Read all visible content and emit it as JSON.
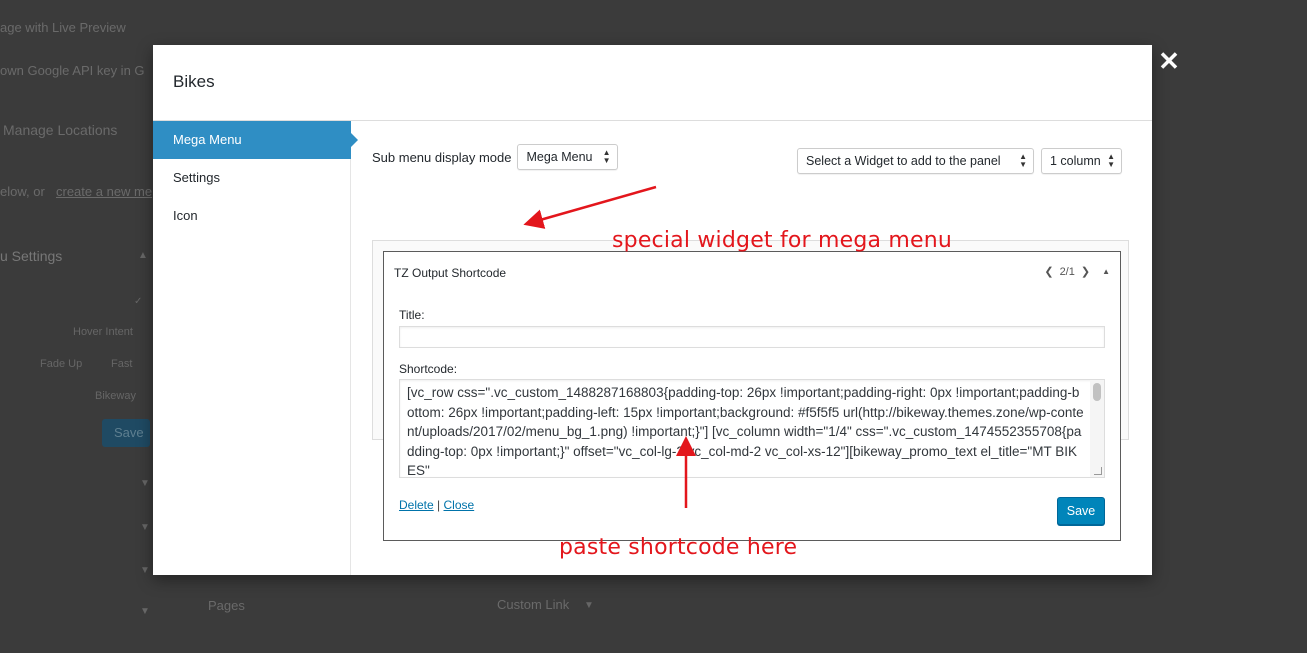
{
  "background": {
    "texts": [
      "age with Live Preview",
      "own Google API key in G",
      "Manage Locations",
      "elow, or",
      "create a new me",
      "u Settings",
      "Hover Intent",
      "Fade Up",
      "Fast",
      "Bikeway",
      "Save",
      "Pages",
      "Custom Link"
    ]
  },
  "modal": {
    "title": "Bikes",
    "close_icon": "close-icon"
  },
  "sidebar": {
    "items": [
      {
        "label": "Mega Menu"
      },
      {
        "label": "Settings"
      },
      {
        "label": "Icon"
      }
    ]
  },
  "controls": {
    "mode_label": "Sub menu display mode",
    "mode_value": "Mega Menu",
    "widget_select": "Select a Widget to add to the panel",
    "column_select": "1 column"
  },
  "widget": {
    "title": "TZ Output Shortcode",
    "pager": "2/1",
    "title_label": "Title:",
    "title_value": "",
    "shortcode_label": "Shortcode:",
    "shortcode_value": "[vc_row css=\".vc_custom_1488287168803{padding-top: 26px !important;padding-right: 0px !important;padding-bottom: 26px !important;padding-left: 15px !important;background: #f5f5f5 url(http://bikeway.themes.zone/wp-content/uploads/2017/02/menu_bg_1.png) !important;}\"] [vc_column width=\"1/4\" css=\".vc_custom_1474552355708{padding-top: 0px !important;}\" offset=\"vc_col-lg-2 vc_col-md-2 vc_col-xs-12\"][bikeway_promo_text el_title=\"MT BIKES\"",
    "delete_label": "Delete",
    "separator": "|",
    "close_label": "Close",
    "save_label": "Save"
  },
  "annotations": {
    "widget_note": "special widget for mega menu",
    "paste_note": "paste shortcode here",
    "color": "#e3161c"
  },
  "colors": {
    "accent": "#2f8ec4",
    "primary_button": "#0085ba"
  }
}
